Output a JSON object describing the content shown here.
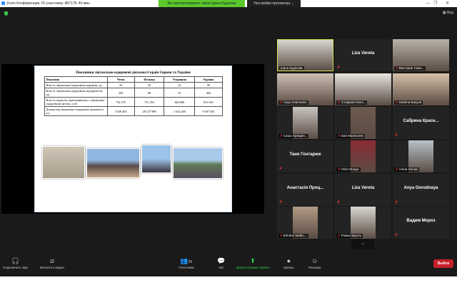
{
  "window": {
    "title": "Zoom Конференция, ID участника: 487178, 40 мин",
    "banner": "Вы просматриваете экран Ірина Кудінова",
    "view_options": "Настройки просмотра ⌄",
    "view_button": "Вид"
  },
  "slide": {
    "title": "Показники лікувально-оздоровчої діяльності країн Європи та України",
    "headers": [
      "Показник",
      "Чехія",
      "Польща",
      "Угорщина",
      "Україна"
    ],
    "rows": [
      [
        "Кіль-ть лікувально-оздоровчих курортів, од.",
        "33",
        "43",
        "22",
        "58"
      ],
      [
        "Кіль-ть лікувально-оздоровчих підприємств, од.",
        "250",
        "88",
        "35",
        "404"
      ],
      [
        "Кіль-ть туристів, відпочиваючих з лікувально-оздоровчою метою, осіб",
        "732 276",
        "731 453",
        "663 000",
        "651 943"
      ],
      [
        "Доходи від лікувально-оздоровчої діяльності, у.о.",
        "3 526 463",
        "28 127 989",
        "1 614 440",
        "9 507 504"
      ]
    ]
  },
  "participants": [
    {
      "name": "Ірина Кудінова",
      "video": true,
      "active": true
    },
    {
      "name": "Liza Vereta",
      "video": false
    },
    {
      "name": "Виктория Самс...",
      "video": true
    },
    {
      "name": "Anya Artamanko",
      "video": true
    },
    {
      "name": "Стефанія Мосі...",
      "video": true
    },
    {
      "name": "Darkina Basyuk",
      "video": true
    },
    {
      "name": "Саша Хрещен...",
      "video": true
    },
    {
      "name": "Dari Mashovets",
      "video": true
    },
    {
      "name": "Сабрина Красн...",
      "video": false
    },
    {
      "name": "Таня Гонтарюк",
      "video": false
    },
    {
      "name": "Лілія Жакун",
      "video": true
    },
    {
      "name": "Аліна Хилюк",
      "video": true
    },
    {
      "name": "Анастасія Проц...",
      "video": false
    },
    {
      "name": "Liza Vereta",
      "video": false
    },
    {
      "name": "Anya Gorodnaya",
      "video": false
    },
    {
      "name": "Bohdan Matko...",
      "video": true
    },
    {
      "name": "Роман Брыль",
      "video": true
    },
    {
      "name": "Вадим Мороз",
      "video": false
    }
  ],
  "toolbar": {
    "audio": "Подключить звук",
    "video": "Включить видео",
    "participants": "Участники",
    "participants_count": "29",
    "chat": "Чат",
    "share": "Демонстрация экрана",
    "record": "Запись",
    "reactions": "Реакции",
    "leave": "Выйти"
  },
  "colors": {
    "banner": "#5bc82b",
    "leave": "#c8202a",
    "active_border": "#cfe04a"
  }
}
